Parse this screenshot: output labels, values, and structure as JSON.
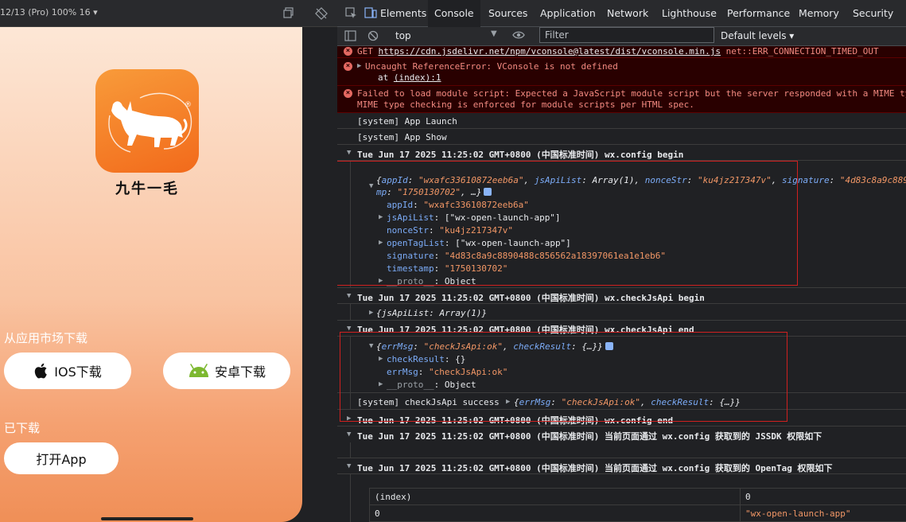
{
  "device": {
    "info": "12/13 (Pro) 100% 16 ▾",
    "app_name": "九牛一毛",
    "logo_mark": "®",
    "market_label": "从应用市场下载",
    "ios_button": "IOS下载",
    "android_button": "安卓下载",
    "downloaded_label": "已下载",
    "open_button": "打开App"
  },
  "devtools": {
    "tabs": [
      "Elements",
      "Console",
      "Sources",
      "Application",
      "Network",
      "Lighthouse",
      "Performance",
      "Memory",
      "Security"
    ],
    "active_tab": "Console",
    "context": "top",
    "filter_placeholder": "Filter",
    "levels": "Default levels ▾"
  },
  "console": {
    "err1": {
      "prefix": "GET ",
      "url": "https://cdn.jsdelivr.net/npm/vconsole@latest/dist/vconsole.min.js",
      "error": " net::ERR_CONNECTION_TIMED_OUT"
    },
    "err2": {
      "line1": "Uncaught ReferenceError: VConsole is not defined",
      "line2_prefix": "at ",
      "line2_link": "(index):1"
    },
    "err3": {
      "line1": "Failed to load module script: Expected a JavaScript module script but the server responded with a MIME ty",
      "line2": "MIME type checking is enforced for module scripts per HTML spec."
    },
    "launch": "[system] App Launch",
    "show": "[system] App Show",
    "config_begin": "Tue Jun 17 2025 11:25:02 GMT+0800 (中国标准时间) wx.config begin",
    "config_obj": {
      "summary_open": "{",
      "appId_key": "appId",
      "appId_val": "\"wxafc33610872eeb6a\"",
      "jsApiList_key": "jsApiList",
      "jsApiList_summary": "Array(1)",
      "nonceStr_key": "nonceStr",
      "nonceStr_val": "\"ku4jz217347v\"",
      "signature_key": "signature",
      "signature_short": "\"4d83c8a9c889",
      "timestamp_tail_key": "mp",
      "timestamp_val": "\"1750130702\"",
      "summary_close": ", …}",
      "jsApiList_val": "[\"wx-open-launch-app\"]",
      "openTagList_key": "openTagList",
      "openTagList_val": "[\"wx-open-launch-app\"]",
      "signature_val": "\"4d83c8a9c8890488c856562a18397061ea1e1eb6\"",
      "timestamp_key": "timestamp",
      "proto_key": "__proto__",
      "proto_val": "Object"
    },
    "checkjs_begin": "Tue Jun 17 2025 11:25:02 GMT+0800 (中国标准时间) wx.checkJsApi begin",
    "checkjs_arg": "{jsApiList: Array(1)}",
    "checkjs_end": "Tue Jun 17 2025 11:25:02 GMT+0800 (中国标准时间) wx.checkJsApi end",
    "check_obj": {
      "errMsg_key": "errMsg",
      "errMsg_val": "\"checkJsApi:ok\"",
      "checkResult_key": "checkResult",
      "checkResult_summary": "{…}",
      "checkResult_val": "{}",
      "proto_key": "__proto__",
      "proto_val": "Object"
    },
    "check_success": "[system] checkJsApi success",
    "config_end": "Tue Jun 17 2025 11:25:02 GMT+0800 (中国标准时间) wx.config end",
    "jssdk_header": "Tue Jun 17 2025 11:25:02 GMT+0800 (中国标准时间) 当前页面通过 wx.config 获取到的 JSSDK 权限如下",
    "opentag_header": "Tue Jun 17 2025 11:25:02 GMT+0800 (中国标准时间) 当前页面通过 wx.config 获取到的 OpenTag 权限如下",
    "table": {
      "headers": [
        "(index)",
        "0"
      ],
      "rows": [
        [
          "0",
          "\"wx-open-launch-app\""
        ]
      ]
    }
  }
}
